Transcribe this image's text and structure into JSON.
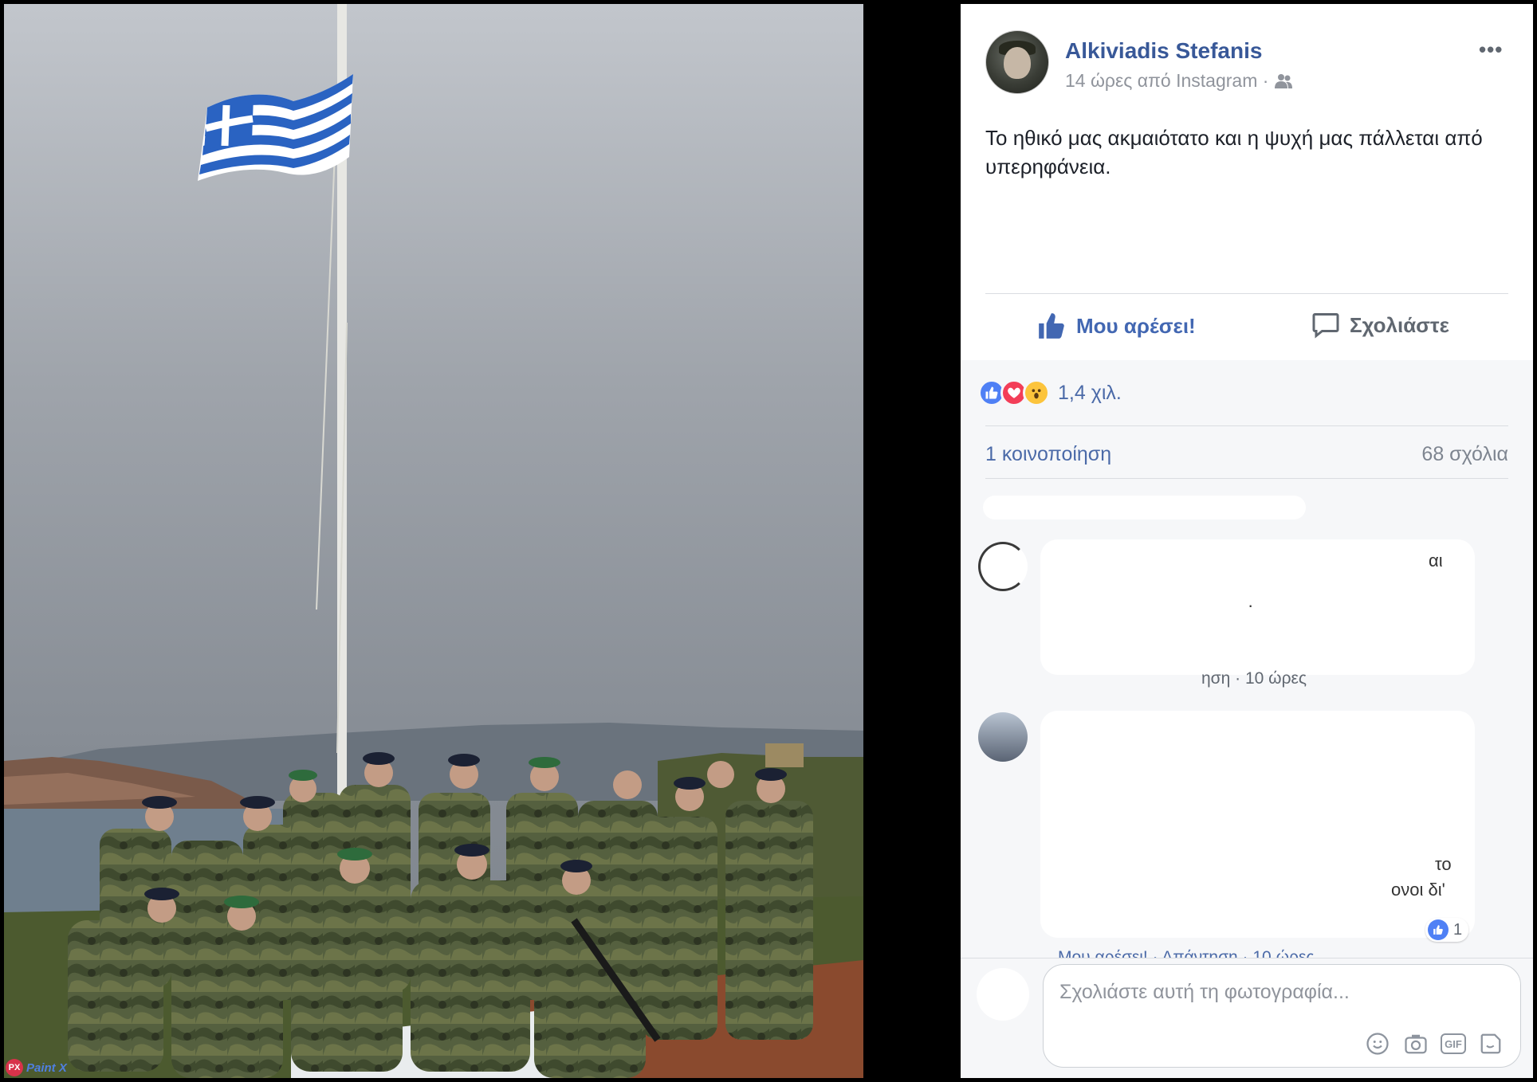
{
  "post": {
    "author": "Alkiviadis Stefanis",
    "meta": "14 ώρες από Instagram ·",
    "caption": "Το ηθικό μας ακμαιότατο και η ψυχή μας πάλλεται από υπερηφάνεια."
  },
  "actions": {
    "like": "Μου αρέσει!",
    "comment": "Σχολιάστε"
  },
  "summary": {
    "reactions": "1,4 χιλ.",
    "shares": "1 κοινοποίηση",
    "comments": "68 σχόλια"
  },
  "comments": [
    {
      "fragment_right": "αι",
      "fragment_mid": "·",
      "footer": "ηση · 10 ώρες"
    },
    {
      "fragment_right": "το",
      "fragment_tail": "ονοι δι'",
      "footer": "Μου αρέσει! · Απάντηση · 10 ώρες",
      "likes": "1"
    }
  ],
  "composer": {
    "placeholder": "Σχολιάστε αυτή τη φωτογραφία...",
    "gif_label": "GIF"
  },
  "watermark": {
    "app": "Paint X",
    "badge": "PX"
  },
  "colors": {
    "link": "#385898",
    "like_blue": "#4267b2",
    "panel_bg": "#f6f7f9"
  }
}
